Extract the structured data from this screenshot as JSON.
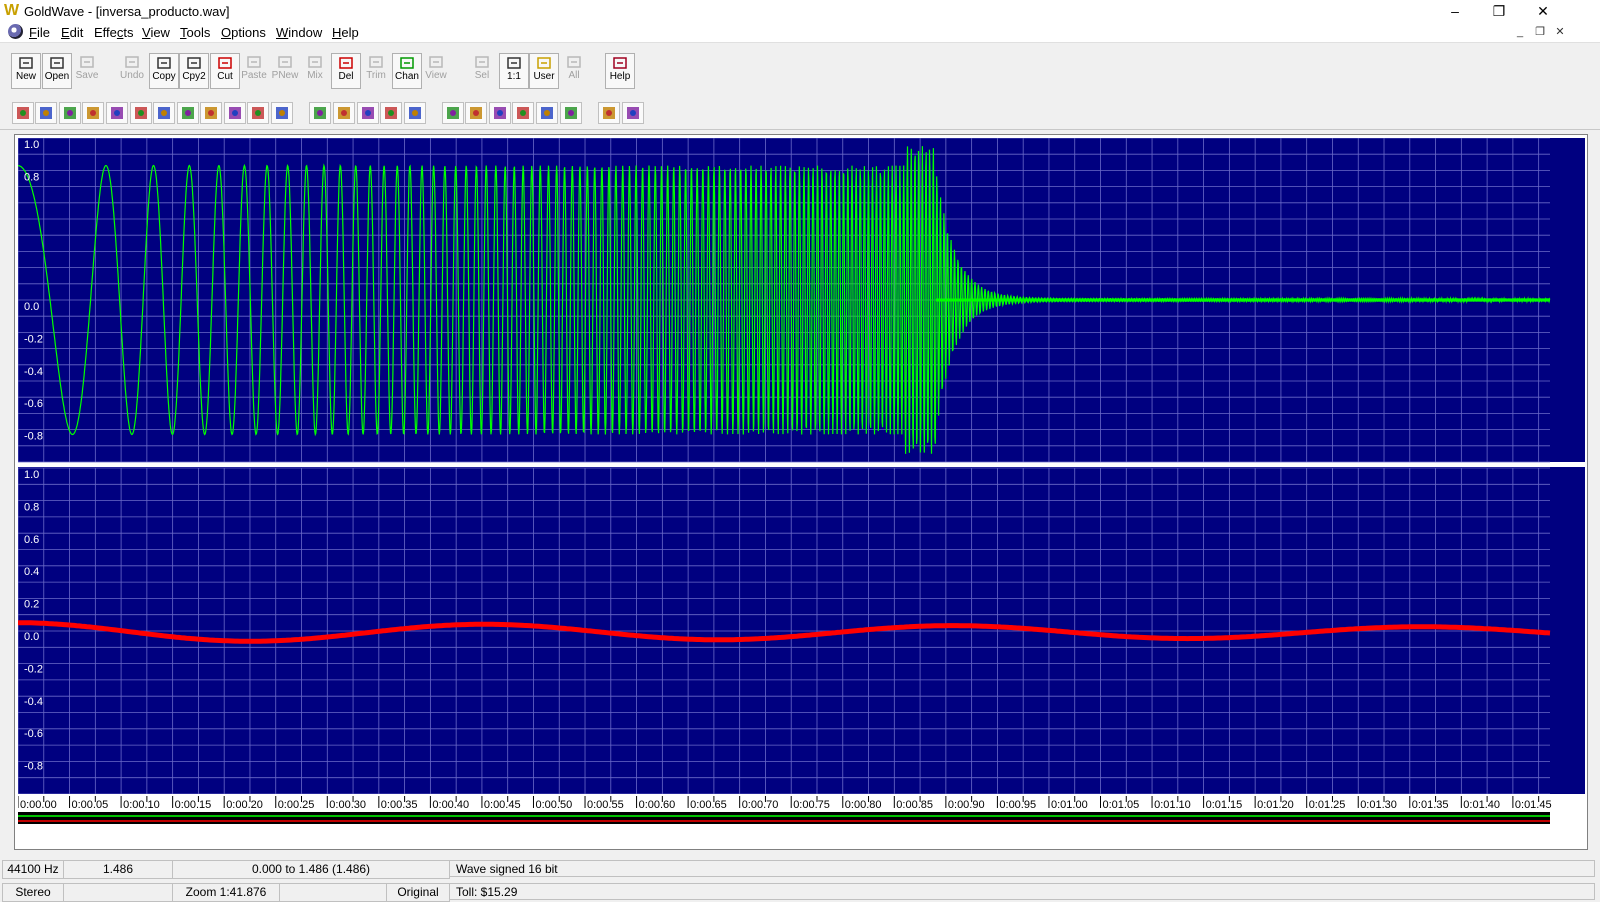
{
  "window": {
    "title": "GoldWave - [inversa_producto.wav]",
    "minimize": "–",
    "restore": "❐",
    "close": "✕"
  },
  "menu": [
    "File",
    "Edit",
    "Effects",
    "View",
    "Tools",
    "Options",
    "Window",
    "Help"
  ],
  "menu_underline": [
    "F",
    "E",
    "c",
    "V",
    "T",
    "O",
    "W",
    "H"
  ],
  "toolbar": {
    "buttons": [
      {
        "label": "New",
        "icon": "new-file-icon",
        "enabled": true
      },
      {
        "label": "Open",
        "icon": "open-file-icon",
        "enabled": true
      },
      {
        "label": "Save",
        "icon": "save-icon",
        "enabled": false
      },
      {
        "label": "Undo",
        "icon": "undo-icon",
        "enabled": false
      },
      {
        "label": "Copy",
        "icon": "copy-icon",
        "enabled": true
      },
      {
        "label": "Cpy2",
        "icon": "copy2-icon",
        "enabled": true
      },
      {
        "label": "Cut",
        "icon": "scissors-icon",
        "enabled": true
      },
      {
        "label": "Paste",
        "icon": "paste-icon",
        "enabled": false
      },
      {
        "label": "PNew",
        "icon": "paste-new-icon",
        "enabled": false
      },
      {
        "label": "Mix",
        "icon": "mix-icon",
        "enabled": false
      },
      {
        "label": "Del",
        "icon": "delete-icon",
        "enabled": true
      },
      {
        "label": "Trim",
        "icon": "trim-icon",
        "enabled": false
      },
      {
        "label": "Chan",
        "icon": "channel-icon",
        "enabled": true
      },
      {
        "label": "View",
        "icon": "view-icon",
        "enabled": false
      },
      {
        "label": "Sel",
        "icon": "zoom-select-icon",
        "enabled": false
      },
      {
        "label": "1:1",
        "icon": "zoom-1to1-icon",
        "enabled": true
      },
      {
        "label": "User",
        "icon": "zoom-user-icon",
        "enabled": true
      },
      {
        "label": "All",
        "icon": "zoom-all-icon",
        "enabled": false
      },
      {
        "label": "Help",
        "icon": "help-book-icon",
        "enabled": true
      }
    ],
    "effects_icons": [
      "auto-gain-icon",
      "change-pitch-icon",
      "dynamics-icon",
      "echo-icon",
      "equalizer-icon",
      "fade-icon",
      "filter-icon",
      "invert-icon",
      "markers-icon",
      "mechanize-icon",
      "offset-icon",
      "pan-icon",
      "playback-rate-icon",
      "resample-icon",
      "reverse-icon",
      "silence-icon",
      "time-warp-icon",
      "volume-icon",
      "doppler-icon",
      "interpolate-icon",
      "noise-reduction-icon",
      "spectrum-filter-icon",
      "stereo-icon",
      "meter-icon",
      "expression-evaluator-icon"
    ]
  },
  "waveform": {
    "background": "#000080",
    "grid_color": "#6a6ac8",
    "left_channel_color": "#00ff00",
    "right_channel_color": "#ff0000",
    "top_ticks": [
      "1.0",
      "0.8",
      "0.0",
      "-0.2",
      "-0.4",
      "-0.6",
      "-0.8"
    ],
    "bottom_ticks": [
      "1.0",
      "0.8",
      "0.6",
      "0.4",
      "0.2",
      "0.0",
      "-0.2",
      "-0.4",
      "-0.6",
      "-0.8"
    ],
    "time_labels": [
      "0:00.00",
      "0:00.05",
      "0:00.10",
      "0:00.15",
      "0:00.20",
      "0:00.25",
      "0:00.30",
      "0:00.35",
      "0:00.40",
      "0:00.45",
      "0:00.50",
      "0:00.55",
      "0:00.60",
      "0:00.65",
      "0:00.70",
      "0:00.75",
      "0:00.80",
      "0:00.85",
      "0:00.90",
      "0:00.95",
      "0:01.00",
      "0:01.05",
      "0:01.10",
      "0:01.15",
      "0:01.20",
      "0:01.25",
      "0:01.30",
      "0:01.35",
      "0:01.40",
      "0:01.45"
    ]
  },
  "status": {
    "rate": "44100 Hz",
    "length": "1.486",
    "range": "0.000 to 1.486 (1.486)",
    "format": "Wave signed 16 bit",
    "channels": "Stereo",
    "zoom": "Zoom 1:41.876",
    "original": "Original",
    "toll": "Toll: $15.29"
  }
}
